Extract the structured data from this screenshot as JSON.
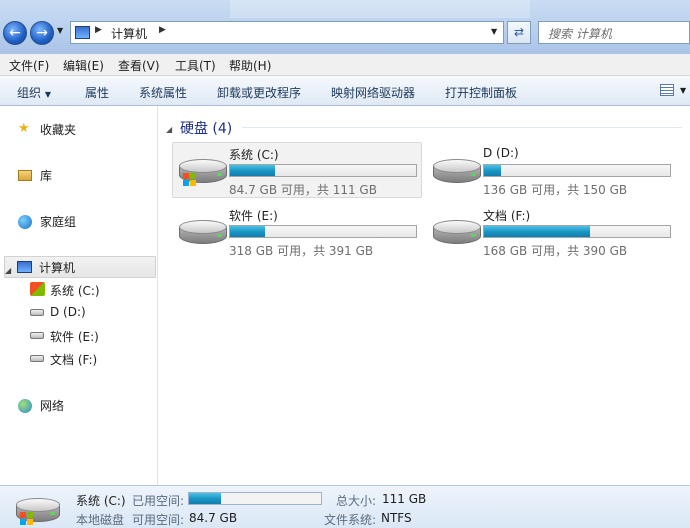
{
  "address": {
    "location": "计算机"
  },
  "search": {
    "placeholder": "搜索 计算机"
  },
  "menu": [
    "文件(F)",
    "编辑(E)",
    "查看(V)",
    "工具(T)",
    "帮助(H)"
  ],
  "commands": {
    "organize": "组织",
    "properties": "属性",
    "system_properties": "系统属性",
    "uninstall": "卸载或更改程序",
    "map_drive": "映射网络驱动器",
    "control_panel": "打开控制面板"
  },
  "nav": {
    "favorites": "收藏夹",
    "libraries": "库",
    "homegroup": "家庭组",
    "computer": "计算机",
    "drives": [
      "系统 (C:)",
      "D (D:)",
      "软件 (E:)",
      "文档 (F:)"
    ],
    "network": "网络"
  },
  "content": {
    "group_title": "硬盘 (4)",
    "drives": [
      {
        "name": "系统 (C:)",
        "info": "84.7 GB 可用，共 111 GB",
        "used_fraction": 0.24
      },
      {
        "name": "D (D:)",
        "info": "136 GB 可用，共 150 GB",
        "used_fraction": 0.09
      },
      {
        "name": "软件 (E:)",
        "info": "318 GB 可用，共 391 GB",
        "used_fraction": 0.19
      },
      {
        "name": "文档 (F:)",
        "info": "168 GB 可用，共 390 GB",
        "used_fraction": 0.57
      }
    ]
  },
  "details": {
    "name": "系统 (C:)",
    "used_label": "已用空间:",
    "used_fraction": 0.24,
    "type": "本地磁盘",
    "free_label": "可用空间:",
    "free_value": "84.7 GB",
    "total_label": "总大小:",
    "total_value": "111 GB",
    "fs_label": "文件系统:",
    "fs_value": "NTFS"
  },
  "colors": {
    "accent": "#1b97c6",
    "group_header": "#1e3287"
  }
}
